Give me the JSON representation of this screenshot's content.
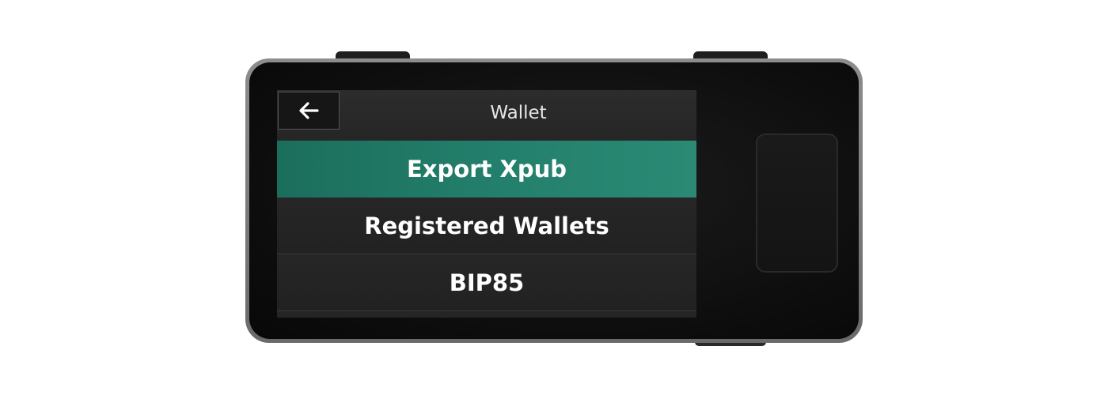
{
  "header": {
    "back_icon": "arrow-left-icon",
    "title": "Wallet"
  },
  "menu": {
    "items": [
      {
        "label": "Export Xpub",
        "selected": true
      },
      {
        "label": "Registered Wallets",
        "selected": false
      },
      {
        "label": "BIP85",
        "selected": false
      }
    ]
  },
  "colors": {
    "accent": "#23806c",
    "screen_bg": "#252525",
    "device_bezel": "#0d0d0d"
  }
}
